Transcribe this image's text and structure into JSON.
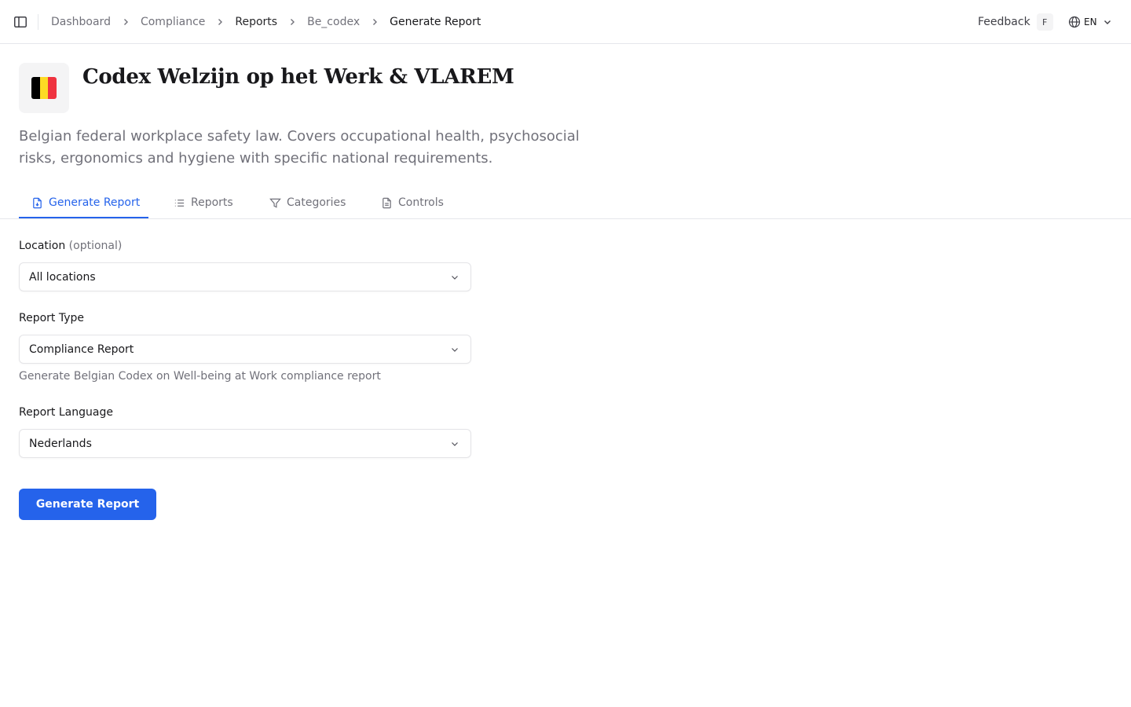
{
  "breadcrumb": [
    "Dashboard",
    "Compliance",
    "Reports",
    "Be_codex",
    "Generate Report"
  ],
  "topbar": {
    "feedback_label": "Feedback",
    "feedback_shortcut": "F",
    "language_code": "EN"
  },
  "header": {
    "title": "Codex Welzijn op het Werk & VLAREM",
    "description": "Belgian federal workplace safety law. Covers occupational health, psychosocial risks, ergonomics and hygiene with specific national requirements.",
    "flag_colors": [
      "#000000",
      "#FDDA24",
      "#EF3340"
    ]
  },
  "tabs": [
    {
      "label": "Generate Report",
      "icon": "file-download-icon",
      "active": true
    },
    {
      "label": "Reports",
      "icon": "list-icon",
      "active": false
    },
    {
      "label": "Categories",
      "icon": "filter-icon",
      "active": false
    },
    {
      "label": "Controls",
      "icon": "document-icon",
      "active": false
    }
  ],
  "form": {
    "location": {
      "label": "Location",
      "optional": "(optional)",
      "value": "All locations"
    },
    "report_type": {
      "label": "Report Type",
      "value": "Compliance Report",
      "hint": "Generate Belgian Codex on Well-being at Work compliance report"
    },
    "report_language": {
      "label": "Report Language",
      "value": "Nederlands"
    },
    "submit_label": "Generate Report"
  },
  "colors": {
    "accent": "#2563eb",
    "border": "#e5e7eb",
    "muted_text": "#71717a"
  }
}
